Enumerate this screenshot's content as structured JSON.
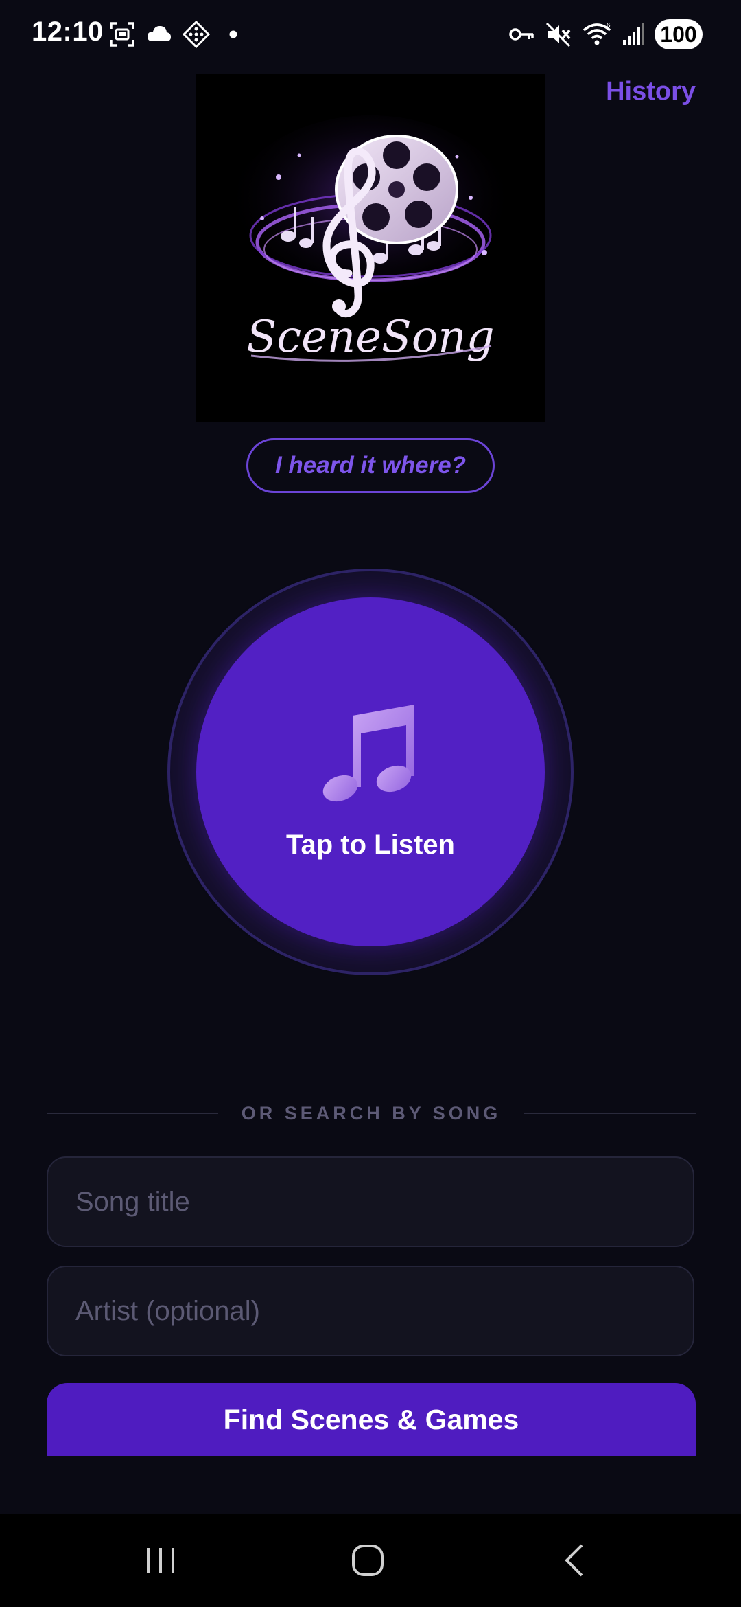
{
  "status_bar": {
    "time": "12:10",
    "left_icons": [
      "screenshot-icon",
      "cloud-icon",
      "diamond-app-icon",
      "dot-icon"
    ],
    "right_icons": [
      "vpn-key-icon",
      "mute-icon",
      "wifi-icon",
      "signal-icon"
    ],
    "battery": "100"
  },
  "header": {
    "history_label": "History"
  },
  "logo": {
    "wordmark": "SceneSong",
    "icons": [
      "treble-clef-icon",
      "film-reel-icon",
      "music-notes-icon"
    ]
  },
  "tagline": "I heard it where?",
  "listen": {
    "label": "Tap to Listen",
    "icon": "music-note-icon"
  },
  "search": {
    "divider_label": "OR SEARCH BY SONG",
    "title_placeholder": "Song title",
    "title_value": "",
    "artist_placeholder": "Artist (optional)",
    "artist_value": "",
    "submit_label": "Find Scenes & Games"
  },
  "nav": {
    "icons": [
      "recents-icon",
      "home-icon",
      "back-icon"
    ]
  },
  "colors": {
    "background": "#0a0a14",
    "accent": "#5220c4",
    "link": "#7b4fe6",
    "field_bg": "#13131f"
  }
}
